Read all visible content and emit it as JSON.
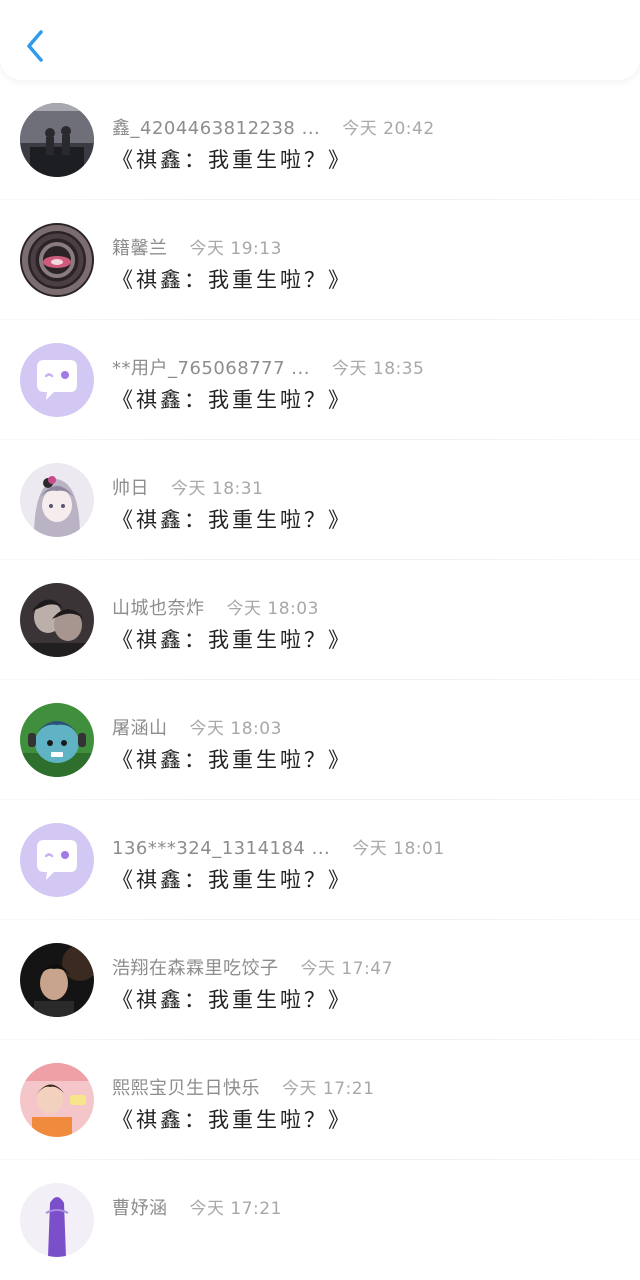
{
  "header": {
    "back_icon": "chevron-left-icon",
    "accent_color": "#2f9bec"
  },
  "items": [
    {
      "username": "鑫_4204463812238 ...",
      "time": "今天 20:42",
      "title": "《祺鑫：我重生啦？》",
      "avatar": "photo"
    },
    {
      "username": "籍馨兰",
      "time": "今天 19:13",
      "title": "《祺鑫：我重生啦？》",
      "avatar": "photo"
    },
    {
      "username": "**用户_765068777 ...",
      "time": "今天 18:35",
      "title": "《祺鑫：我重生啦？》",
      "avatar": "default-chat"
    },
    {
      "username": "帅日",
      "time": "今天 18:31",
      "title": "《祺鑫：我重生啦？》",
      "avatar": "photo"
    },
    {
      "username": "山城也奈炸",
      "time": "今天 18:03",
      "title": "《祺鑫：我重生啦？》",
      "avatar": "photo"
    },
    {
      "username": "屠涵山",
      "time": "今天 18:03",
      "title": "《祺鑫：我重生啦？》",
      "avatar": "cartoon"
    },
    {
      "username": "136***324_1314184 ...",
      "time": "今天 18:01",
      "title": "《祺鑫：我重生啦？》",
      "avatar": "default-chat"
    },
    {
      "username": "浩翔在森霖里吃饺子",
      "time": "今天 17:47",
      "title": "《祺鑫：我重生啦？》",
      "avatar": "photo"
    },
    {
      "username": "熙熙宝贝生日快乐",
      "time": "今天 17:21",
      "title": "《祺鑫：我重生啦？》",
      "avatar": "photo"
    },
    {
      "username": "曹妤涵",
      "time": "今天 17:21",
      "title": "",
      "avatar": "photo"
    }
  ]
}
